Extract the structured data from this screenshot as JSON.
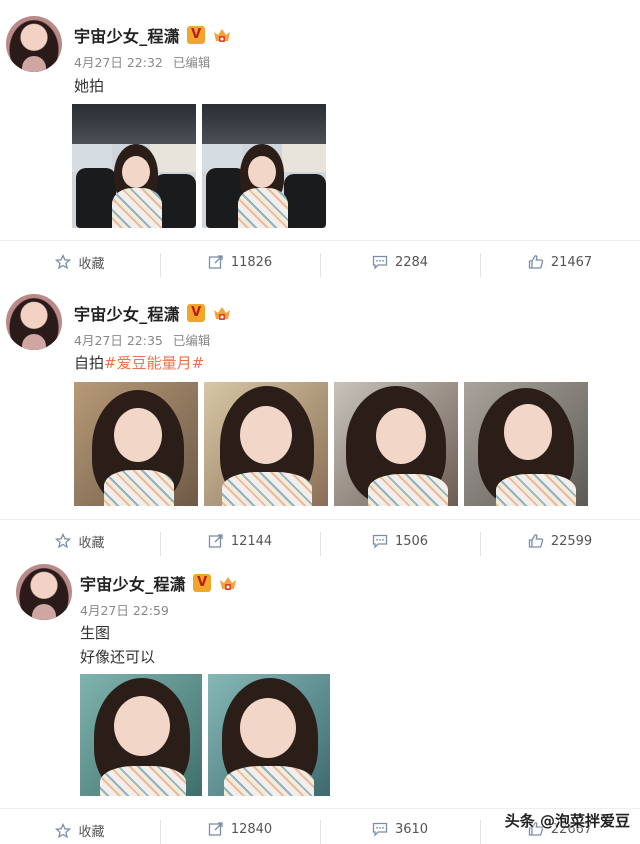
{
  "posts": [
    {
      "name": "宇宙少女_程潇",
      "verified_badge": "V",
      "date": "4月27日 22:32",
      "edited": "已编辑",
      "text": "她拍",
      "tag": "",
      "text_line2": "",
      "actions": {
        "fav": "收藏",
        "repost": "11826",
        "comment": "2284",
        "like": "21467"
      }
    },
    {
      "name": "宇宙少女_程潇",
      "verified_badge": "V",
      "date": "4月27日 22:35",
      "edited": "已编辑",
      "text": "自拍",
      "tag": "#爱豆能量月#",
      "text_line2": "",
      "actions": {
        "fav": "收藏",
        "repost": "12144",
        "comment": "1506",
        "like": "22599"
      }
    },
    {
      "name": "宇宙少女_程潇",
      "verified_badge": "V",
      "date": "4月27日 22:59",
      "edited": "",
      "text": "生图",
      "tag": "",
      "text_line2": "好像还可以",
      "actions": {
        "fav": "收藏",
        "repost": "12840",
        "comment": "3610",
        "like": "22667"
      }
    }
  ],
  "watermark": {
    "text": "头条 @泡菜拌爱豆"
  },
  "icons": {
    "fav": "star-icon",
    "repost": "share-icon",
    "comment": "comment-icon",
    "like": "thumbs-up-icon",
    "crown": "crown-badge-icon"
  },
  "colors": {
    "tag": "#eb7350",
    "badge": "#f0a52b",
    "meta": "#888888"
  }
}
